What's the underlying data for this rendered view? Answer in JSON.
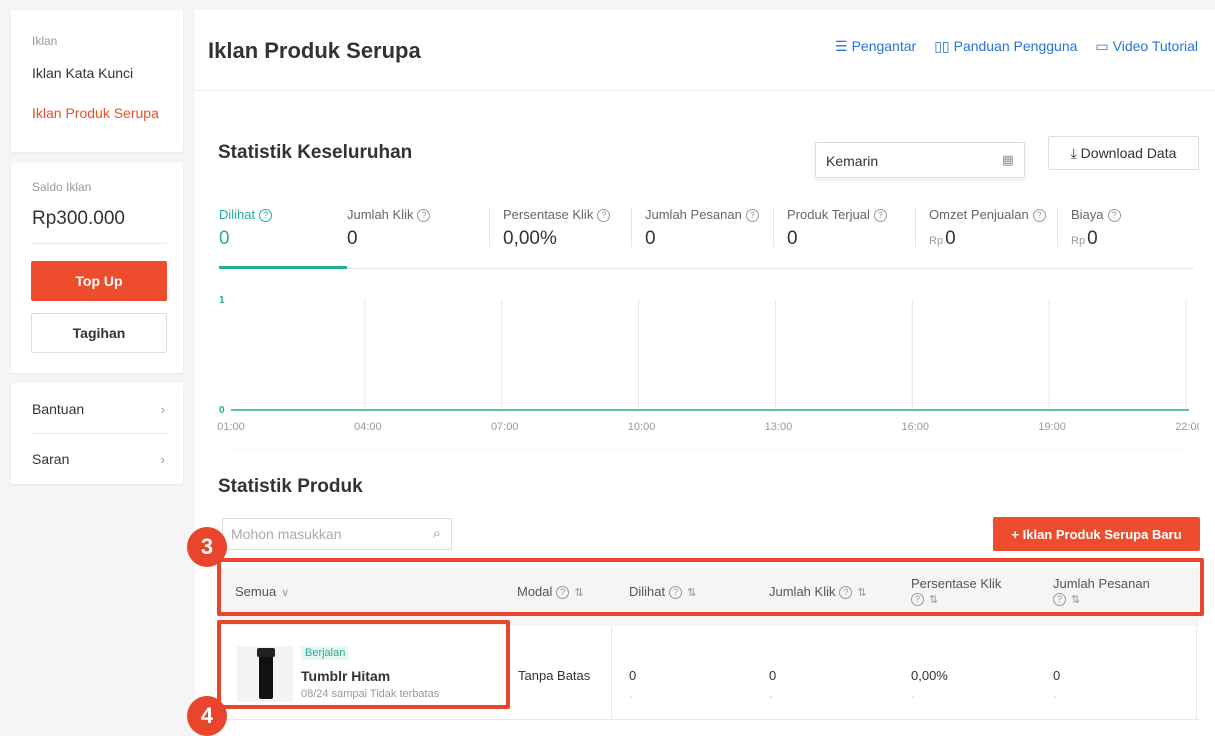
{
  "sidebar": {
    "ads_label": "Iklan",
    "items": [
      "Iklan Kata Kunci",
      "Iklan Produk Serupa"
    ],
    "saldo_label": "Saldo Iklan",
    "saldo_amount": "Rp300.000",
    "topup_label": "Top Up",
    "tagihan_label": "Tagihan",
    "help_items": [
      "Bantuan",
      "Saran"
    ]
  },
  "header": {
    "title": "Iklan Produk Serupa",
    "links": [
      "Pengantar",
      "Panduan Pengguna",
      "Video Tutorial"
    ]
  },
  "overall": {
    "title": "Statistik Keseluruhan",
    "date_value": "Kemarin",
    "download_label": "Download Data",
    "currency_prefix": "Rp",
    "metrics": [
      {
        "name": "Dilihat",
        "value": "0"
      },
      {
        "name": "Jumlah Klik",
        "value": "0"
      },
      {
        "name": "Persentase Klik",
        "value": "0,00%"
      },
      {
        "name": "Jumlah Pesanan",
        "value": "0"
      },
      {
        "name": "Produk Terjual",
        "value": "0"
      },
      {
        "name": "Omzet Penjualan",
        "value": "0"
      },
      {
        "name": "Biaya",
        "value": "0"
      }
    ]
  },
  "chart_data": {
    "type": "line",
    "x": [
      "01:00",
      "04:00",
      "07:00",
      "10:00",
      "13:00",
      "16:00",
      "19:00",
      "22:00"
    ],
    "series": [
      {
        "values": [
          0,
          0,
          0,
          0,
          0,
          0,
          0,
          0
        ]
      }
    ],
    "y_ticks": [
      "1",
      "0"
    ],
    "ylim": [
      0,
      1
    ],
    "color": "#26aa99",
    "grid": "vertical"
  },
  "products": {
    "title": "Statistik Produk",
    "search_placeholder": "Mohon masukkan",
    "new_button": "+ Iklan Produk Serupa Baru",
    "columns": [
      "Semua",
      "Modal",
      "Dilihat",
      "Jumlah Klik",
      "Persentase Klik",
      "Jumlah Pesanan"
    ],
    "rows": [
      {
        "status": "Berjalan",
        "name": "Tumblr Hitam",
        "period": "08/24 sampai Tidak terbatas",
        "modal": "Tanpa Batas",
        "dilihat": "0",
        "klik": "0",
        "persentase": "0,00%",
        "pesanan": "0",
        "dash": "-"
      }
    ]
  },
  "annotations": [
    "3",
    "4"
  ],
  "colors": {
    "accent": "#ee4d2d",
    "teal": "#26aa99",
    "link": "#2673dd",
    "annotation": "#e8452c"
  }
}
